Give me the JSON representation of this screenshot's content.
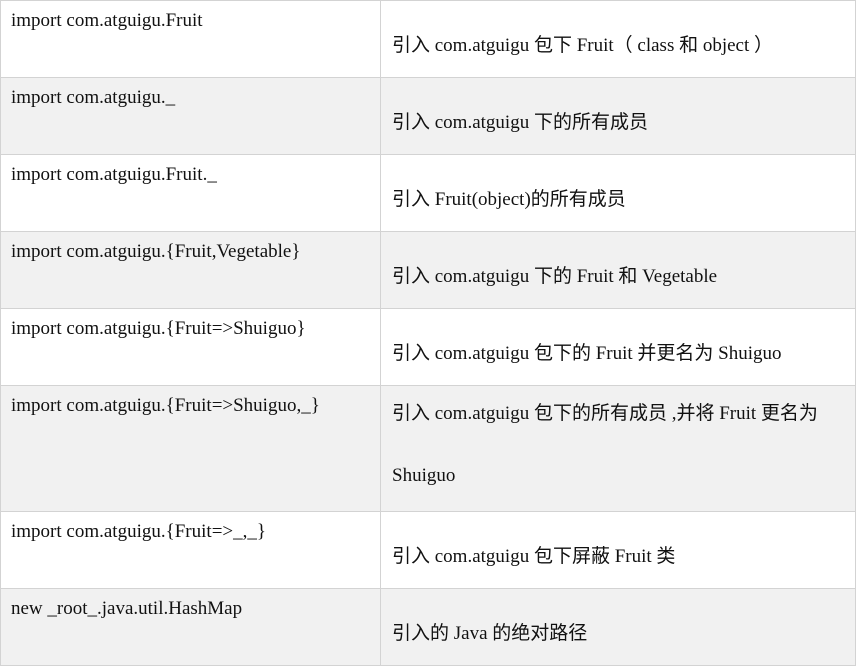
{
  "rows": [
    {
      "code": "import com.atguigu.Fruit",
      "desc": "引入 com.atguigu 包下 Fruit（ class 和 object ）"
    },
    {
      "code": "import com.atguigu._",
      "desc": "引入 com.atguigu 下的所有成员"
    },
    {
      "code": "import com.atguigu.Fruit._",
      "desc": "引入 Fruit(object)的所有成员"
    },
    {
      "code": "import com.atguigu.{Fruit,Vegetable}",
      "desc": "引入 com.atguigu 下的 Fruit 和 Vegetable"
    },
    {
      "code": "import com.atguigu.{Fruit=>Shuiguo}",
      "desc": "引入 com.atguigu 包下的 Fruit 并更名为 Shuiguo"
    },
    {
      "code": "import com.atguigu.{Fruit=>Shuiguo,_}",
      "desc": "引入 com.atguigu 包下的所有成员 ,并将 Fruit 更名为 Shuiguo"
    },
    {
      "code": "import com.atguigu.{Fruit=>_,_}",
      "desc": "引入 com.atguigu 包下屏蔽 Fruit 类"
    },
    {
      "code": "new _root_.java.util.HashMap",
      "desc": "引入的 Java 的绝对路径"
    }
  ]
}
